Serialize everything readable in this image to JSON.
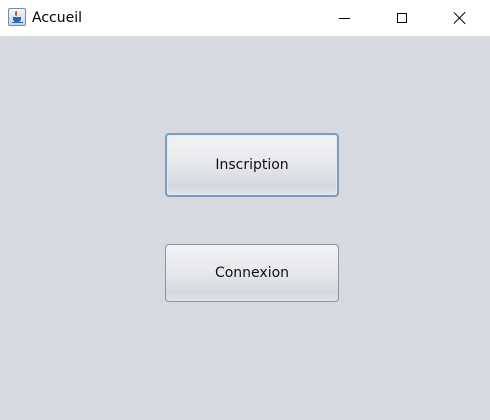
{
  "window": {
    "title": "Accueil",
    "icon": "java-cup-icon"
  },
  "titlebar_controls": {
    "minimize": "minimize-icon",
    "maximize": "maximize-icon",
    "close": "close-icon"
  },
  "main": {
    "inscription_label": "Inscription",
    "connexion_label": "Connexion"
  },
  "colors": {
    "background": "#d6d9e0",
    "titlebar": "#ffffff",
    "focus_border": "#7d9bbd",
    "button_border": "#8d939b"
  }
}
